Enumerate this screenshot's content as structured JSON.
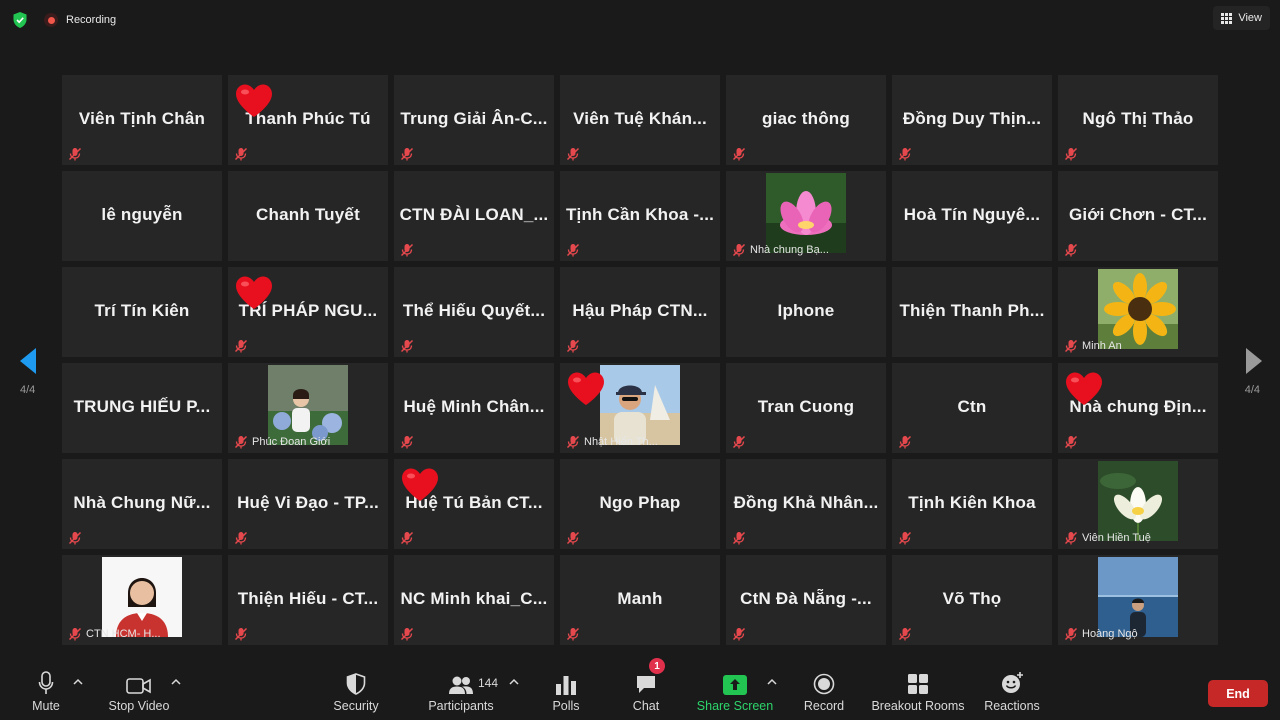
{
  "topbar": {
    "recording_label": "Recording",
    "view_label": "View"
  },
  "pagination": {
    "left_label": "4/4",
    "right_label": "4/4"
  },
  "participants_grid": [
    {
      "name": "Viên Tịnh Chân",
      "muted": true
    },
    {
      "name": "Thanh Phúc Tú",
      "muted": true,
      "reaction": "heart"
    },
    {
      "name": "Trung Giải Ân-C...",
      "muted": true
    },
    {
      "name": "Viên Tuệ  Khán...",
      "muted": true
    },
    {
      "name": "giac thông",
      "muted": true
    },
    {
      "name": "Đồng Duy Thịn...",
      "muted": true
    },
    {
      "name": "Ngô Thị Thảo",
      "muted": true
    },
    {
      "name": "lê nguyễn",
      "muted": false
    },
    {
      "name": "Chanh Tuyết",
      "muted": false
    },
    {
      "name": "CTN ĐÀI LOAN_...",
      "muted": true
    },
    {
      "name": "Tịnh Cần Khoa -...",
      "muted": true
    },
    {
      "name": "Nhà chung Bạ...",
      "muted": true,
      "photo": "lotus-pink",
      "label_in_footer": true
    },
    {
      "name": "Hoà Tín Nguyê...",
      "muted": false
    },
    {
      "name": "Giới Chơn - CT...",
      "muted": true
    },
    {
      "name": "Trí Tín Kiên",
      "muted": false
    },
    {
      "name": "TRÍ PHÁP NGU...",
      "muted": true,
      "reaction": "heart"
    },
    {
      "name": "Thể Hiếu Quyết...",
      "muted": true
    },
    {
      "name": "Hậu Pháp CTN...",
      "muted": true
    },
    {
      "name": "Iphone",
      "muted": false
    },
    {
      "name": "Thiện Thanh Ph...",
      "muted": false
    },
    {
      "name": "Minh An",
      "muted": true,
      "photo": "sunflower",
      "label_in_footer": true
    },
    {
      "name": "TRUNG HIẾU P...",
      "muted": false
    },
    {
      "name": "Phúc Đoan Giới",
      "muted": true,
      "photo": "woman-flowers",
      "label_in_footer": true
    },
    {
      "name": "Huệ Minh Chân...",
      "muted": true
    },
    {
      "name": "Nhật Hiển Th...",
      "muted": true,
      "photo": "man-cap",
      "label_in_footer": true,
      "reaction": "heart"
    },
    {
      "name": "Tran Cuong",
      "muted": true
    },
    {
      "name": "Ctn",
      "muted": true
    },
    {
      "name": "Nhà chung Địn...",
      "muted": true,
      "reaction": "heart"
    },
    {
      "name": "Nhà Chung Nữ...",
      "muted": true
    },
    {
      "name": "Huệ Vi Đạo - TP...",
      "muted": true
    },
    {
      "name": "Huệ Tú Bản CT...",
      "muted": true,
      "reaction": "heart"
    },
    {
      "name": "Ngo Phap",
      "muted": true
    },
    {
      "name": "Đồng Khả Nhân...",
      "muted": true
    },
    {
      "name": "Tịnh Kiên Khoa",
      "muted": true
    },
    {
      "name": "Viên Hiền Tuệ",
      "muted": true,
      "photo": "lotus-white",
      "label_in_footer": true
    },
    {
      "name": "CTN HCM- H...",
      "muted": true,
      "photo": "woman-portrait",
      "label_in_footer": true
    },
    {
      "name": "Thiện Hiếu - CT...",
      "muted": true
    },
    {
      "name": "NC Minh khai_C...",
      "muted": true
    },
    {
      "name": "Manh",
      "muted": true
    },
    {
      "name": "CtN Đà Nẵng -...",
      "muted": true
    },
    {
      "name": "Võ Thọ",
      "muted": true
    },
    {
      "name": "Hoàng Ngộ",
      "muted": true,
      "photo": "man-sea",
      "label_in_footer": true
    }
  ],
  "toolbar": {
    "mute_label": "Mute",
    "stop_video_label": "Stop Video",
    "security_label": "Security",
    "participants_label": "Participants",
    "participants_count": "144",
    "polls_label": "Polls",
    "chat_label": "Chat",
    "chat_badge": "1",
    "share_screen_label": "Share Screen",
    "record_label": "Record",
    "breakout_rooms_label": "Breakout Rooms",
    "reactions_label": "Reactions",
    "end_label": "End"
  },
  "colors": {
    "background": "#1a1a1a",
    "tile": "#262626",
    "muted_icon": "#e5484d",
    "share_green": "#2dd46b",
    "end_red": "#c62828",
    "heart": "#e8101e"
  }
}
